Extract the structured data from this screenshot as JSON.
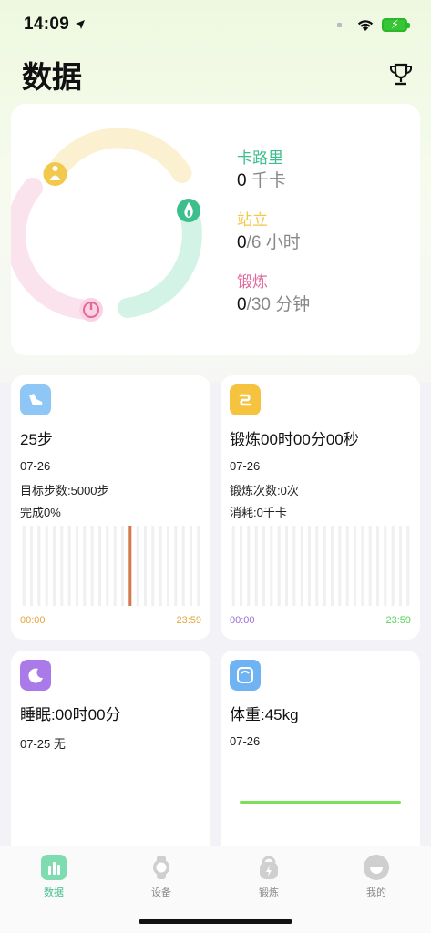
{
  "status_bar": {
    "time": "14:09"
  },
  "header": {
    "title": "数据",
    "trophy_icon": "trophy-icon"
  },
  "activity_ring": {
    "calories": {
      "label": "卡路里",
      "value": "0",
      "unit": " 千卡",
      "color": "#3cbf8c"
    },
    "standing": {
      "label": "站立",
      "value": "0",
      "goal": "/6",
      "unit": " 小时",
      "color": "#f2c94c"
    },
    "exercise": {
      "label": "锻炼",
      "value": "0",
      "goal": "/30",
      "unit": " 分钟",
      "color": "#e2679a"
    }
  },
  "steps_card": {
    "icon": "shoe-icon",
    "title": "25步",
    "date": "07-26",
    "goal": "目标步数:5000步",
    "complete": "完成0%",
    "axis_start": "00:00",
    "axis_end": "23:59",
    "active_bar_index": 14
  },
  "exercise_card": {
    "icon": "exercise-icon",
    "title": "锻炼00时00分00秒",
    "date": "07-26",
    "count": "锻炼次数:0次",
    "burn": "消耗:0千卡",
    "axis_start": "00:00",
    "axis_end": "23:59"
  },
  "sleep_card": {
    "icon": "moon-icon",
    "title": "睡眠:00时00分",
    "date": "07-25 无"
  },
  "weight_card": {
    "icon": "scale-icon",
    "title": "体重:45kg",
    "date": "07-26"
  },
  "tabs": [
    {
      "label": "数据",
      "icon": "data-icon",
      "active": true
    },
    {
      "label": "设备",
      "icon": "watch-icon",
      "active": false
    },
    {
      "label": "锻炼",
      "icon": "kettlebell-icon",
      "active": false
    },
    {
      "label": "我的",
      "icon": "smile-icon",
      "active": false
    }
  ],
  "colors": {
    "accent_green": "#3cbf8c",
    "step_bar": "#d4774a",
    "axis_orange": "#e6a53a",
    "axis_purple": "#9b6dd6",
    "axis_green": "#5bd35b"
  }
}
